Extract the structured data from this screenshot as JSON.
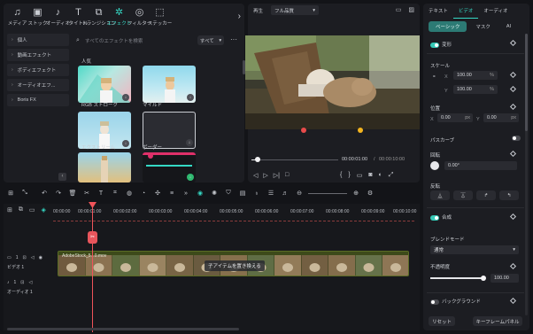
{
  "toolbar": {
    "tools": [
      {
        "icon": "music-note",
        "label": "メディア"
      },
      {
        "icon": "stock-box",
        "label": "ストック"
      },
      {
        "icon": "audio",
        "label": "オーディオ"
      },
      {
        "icon": "title-T",
        "label": "タイトル"
      },
      {
        "icon": "transition",
        "label": "トランジション"
      },
      {
        "icon": "effect-sparkle",
        "label": "エフェクト",
        "active": true
      },
      {
        "icon": "filter",
        "label": "フィルター"
      },
      {
        "icon": "sticker",
        "label": "ステッカー"
      }
    ],
    "next_icon": "chevron-right-icon"
  },
  "sidebar": {
    "items": [
      {
        "label": "個人"
      },
      {
        "label": "動画エフェクト"
      },
      {
        "label": "ボディエフェクト"
      },
      {
        "label": "オーディオエフ..."
      },
      {
        "label": "Boris FX"
      }
    ]
  },
  "search": {
    "placeholder": "すべてのエフェクトを検索"
  },
  "filter": {
    "value": "すべて"
  },
  "effects": {
    "section_title": "人気",
    "items": [
      {
        "label": "RGB ストローク"
      },
      {
        "label": "マイルド"
      },
      {
        "label": "エクストリーム"
      },
      {
        "label": "ボーダー"
      },
      {
        "label": ""
      },
      {
        "label": ""
      }
    ]
  },
  "player": {
    "label": "再生",
    "quality": "フル品質",
    "current_time": "00:00:01:00",
    "separator": "/",
    "total_time": "00:00:10:00",
    "progress": 0.07
  },
  "inspector": {
    "tabs": [
      {
        "label": "テキスト"
      },
      {
        "label": "ビデオ",
        "active": true
      },
      {
        "label": "オーディオ"
      }
    ],
    "subtabs": [
      {
        "label": "ベーシック",
        "active": true
      },
      {
        "label": "マスク"
      },
      {
        "label": "AI"
      }
    ],
    "transform": "変形",
    "scale_label": "スケール",
    "scale_x_label": "X",
    "scale_x": "100.00",
    "scale_y_label": "Y",
    "scale_y": "100.00",
    "percent": "%",
    "position_label": "位置",
    "pos_x_label": "X",
    "pos_x": "0.00",
    "pos_y_label": "Y",
    "pos_y": "0.00",
    "px": "px",
    "path_curve": "パスカーブ",
    "rotate_label": "回転",
    "rotate_value": "0.00°",
    "flip_label": "反転",
    "composite": "合成",
    "blend_label": "ブレンドモード",
    "blend_value": "通常",
    "opacity_label": "不透明度",
    "opacity_value": "100.00",
    "opacity_level": 1.0,
    "background": "バックグラウンド",
    "reset": "リセット",
    "keyframe_panel": "キーフレームパネル"
  },
  "timeline": {
    "ruler": [
      "00:00:00",
      "00:00:01:00",
      "00:00:02:00",
      "00:00:03:00",
      "00:00:04:00",
      "00:00:05:00",
      "00:00:06:00",
      "00:00:07:00",
      "00:00:08:00",
      "00:00:09:00",
      "00:00:10:00"
    ],
    "video_track": "ビデオ 1",
    "audio_track": "オーディオ 1",
    "video_track_num": "1",
    "audio_track_num": "1",
    "clip_name": "AdobeStock_5...0.mov",
    "clip_hint": "子アイテムを置き換える",
    "marker_icon": "scissors-icon"
  },
  "colors": {
    "accent": "#35d9c5",
    "playhead": "#f0545a",
    "clip_bg": "#2f3a14"
  }
}
